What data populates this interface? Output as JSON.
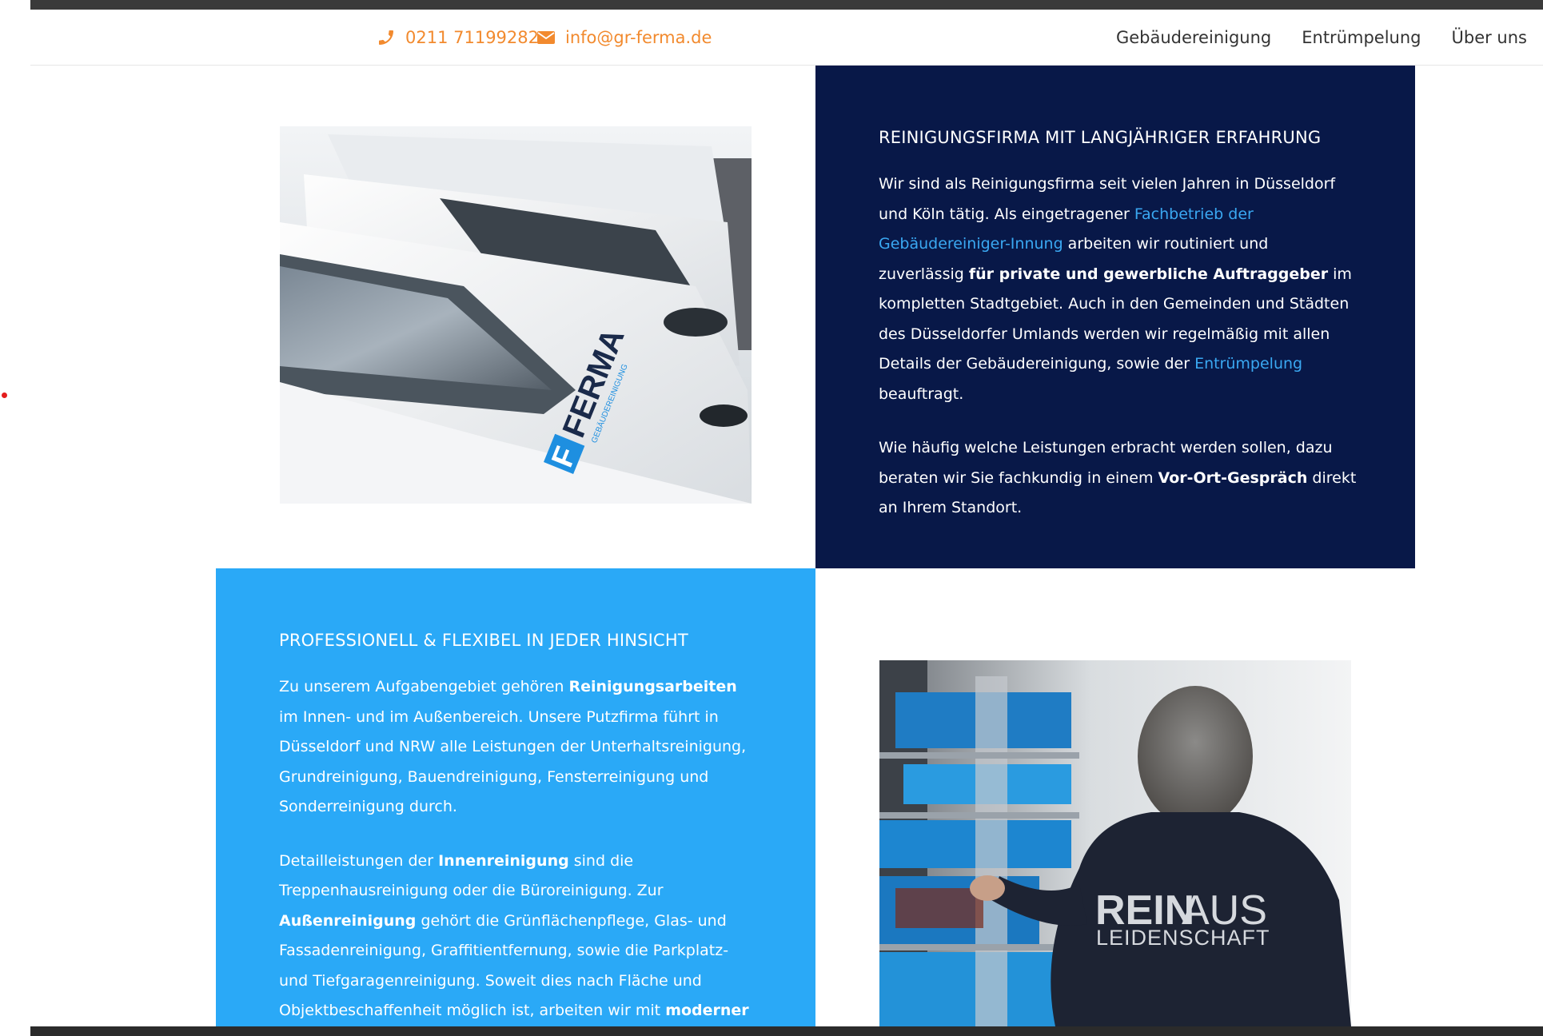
{
  "header": {
    "phone": "0211 71199282",
    "email": "info@gr-ferma.de",
    "nav": [
      "Gebäudereinigung",
      "Entrümpelung",
      "Über uns"
    ],
    "accent_color": "#f28a2e"
  },
  "section1": {
    "image": {
      "kind": "photo of white company cars with FERMA logo",
      "logo_text": "FERMA",
      "logo_sub": "GEBÄUDEREINIGUNG"
    },
    "title": "REINIGUNGSFIRMA MIT LANGJÄHRIGER ERFAHRUNG",
    "p1": {
      "a": "Wir sind als Reinigungsfirma seit vielen Jahren in Düsseldorf und Köln tätig. Als eingetragener ",
      "link1": "Fachbetrieb der Gebäudereiniger-Innung",
      "b": " arbeiten wir routiniert und zuverlässig ",
      "bold1": "für private und gewerbliche Auftraggeber",
      "c": " im kompletten Stadtgebiet. Auch in den Gemeinden und Städten des Düsseldorfer Umlands werden wir regelmäßig mit allen Details der Gebäudereinigung, sowie der ",
      "link2": "Entrümpelung",
      "d": " beauftragt."
    },
    "p2": {
      "a": "Wie häufig welche Leistungen erbracht werden sollen, dazu beraten wir Sie fachkundig in einem ",
      "bold1": "Vor-Ort-Gespräch",
      "b": " direkt an Ihrem Standort."
    },
    "bg_color": "#081848"
  },
  "section2": {
    "title": "PROFESSIONELL & FLEXIBEL IN JEDER HINSICHT",
    "p1": {
      "a": "Zu unserem Aufgabengebiet gehören ",
      "bold1": "Reinigungsarbeiten",
      "b": " im Innen- und im Außenbereich. Unsere Putzfirma führt in Düsseldorf und NRW alle Leistungen der Unterhaltsreinigung, Grundreinigung, Bauendreinigung, Fensterreinigung und Sonderreinigung durch."
    },
    "p2": {
      "a": "Detailleistungen der ",
      "bold1": "Innenreinigung",
      "b": " sind die Treppenhausreinigung oder die Büroreinigung. Zur ",
      "bold2": "Außenreinigung",
      "c": " gehört die Grünflächenpflege, Glas- und Fassadenreinigung, Graffitientfernung, sowie die Parkplatz- und Tiefgaragenreinigung. Soweit dies nach Fläche und Objektbeschaffenheit möglich ist, arbeiten wir mit ",
      "bold3": "moderner"
    },
    "image": {
      "kind": "photo of worker with shirt print",
      "shirt_line1_a": "REIN",
      "shirt_line1_b": "AUS",
      "shirt_line2": "LEIDENSCHAFT"
    },
    "bg_color": "#2aa9f7"
  }
}
